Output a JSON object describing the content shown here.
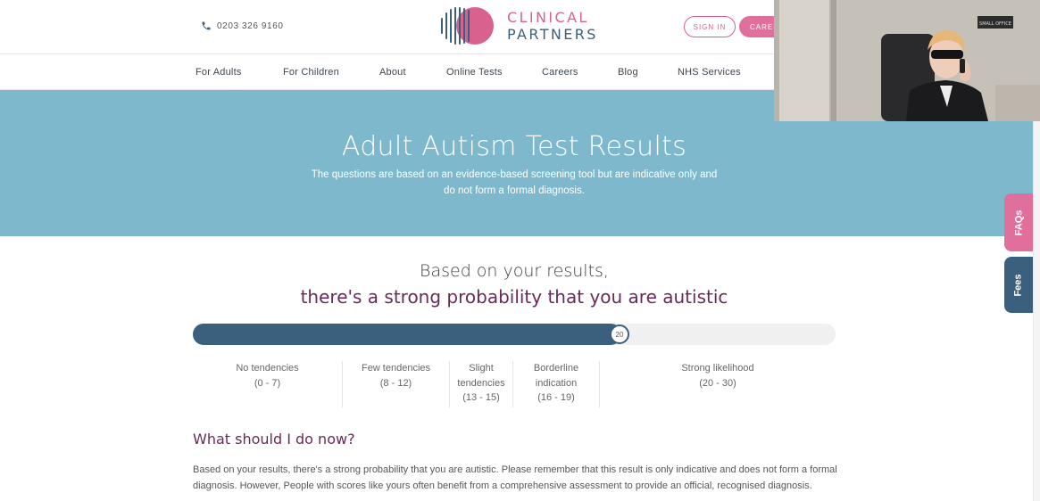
{
  "header": {
    "phone": "0203 326 9160",
    "logo_line1": "CLINICAL",
    "logo_line2": "PARTNERS",
    "sign_in": "SIGN IN",
    "careers_button": "CAREE",
    "brand_pink": "#d9618e",
    "brand_navy": "#3b607d"
  },
  "nav": {
    "items": [
      "For Adults",
      "For Children",
      "About",
      "Online Tests",
      "Careers",
      "Blog",
      "NHS Services"
    ]
  },
  "hero": {
    "title": "Adult Autism Test Results",
    "desc_line1": "The questions are based on an evidence-based screening tool but are indicative only and",
    "desc_line2": "do not form a formal diagnosis.",
    "bg_color": "#7db8cc"
  },
  "result": {
    "line1": "Based on your results,",
    "line2": "there's a strong probability that you are autistic",
    "score": 20,
    "score_label": "20",
    "progress_fraction": 0.666
  },
  "bands": [
    {
      "lines": [
        "No tendencies",
        "(0 - 7)"
      ]
    },
    {
      "lines": [
        "Few tendencies",
        "(8 - 12)"
      ]
    },
    {
      "lines": [
        "Slight",
        "tendencies",
        "(13 - 15)"
      ]
    },
    {
      "lines": [
        "Borderline",
        "indication",
        "(16 - 19)"
      ]
    },
    {
      "lines": [
        "Strong likelihood",
        "(20 - 30)"
      ]
    }
  ],
  "next": {
    "title": "What should I do now?",
    "body": "Based on your results, there's a strong probability that you are autistic. Please remember that this result is only indicative and does not form a formal diagnosis. However, People with scores like yours often benefit from a comprehensive assessment to provide an official, recognised diagnosis."
  },
  "side_tabs": {
    "faqs": "FAQs",
    "fees": "Fees"
  },
  "webcam": {
    "sign_text": "SMALL OFFICE"
  }
}
